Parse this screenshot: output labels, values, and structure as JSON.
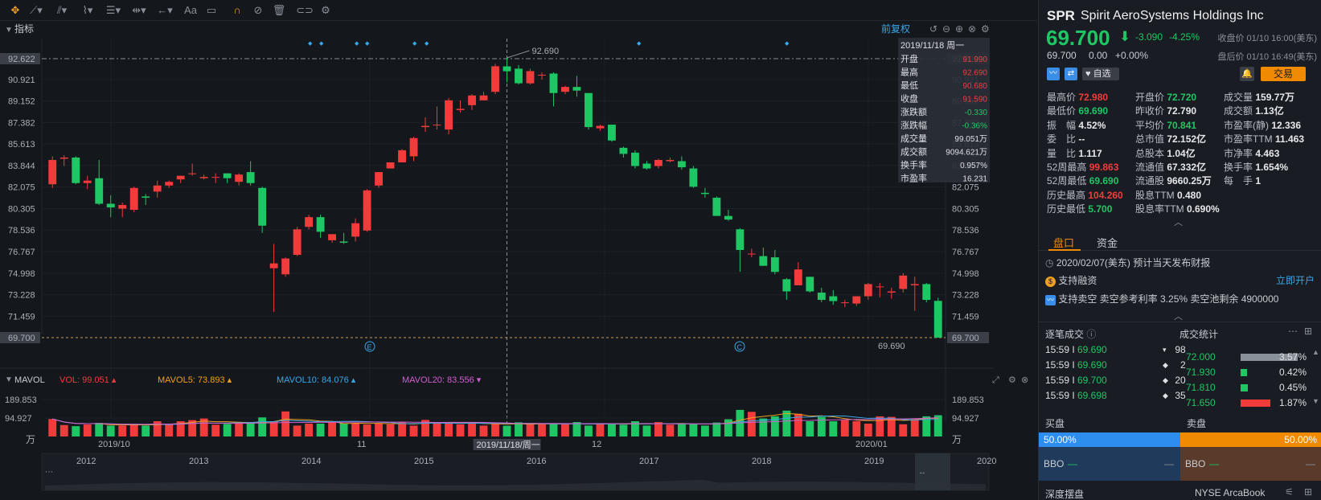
{
  "toolbar": {
    "icons": [
      "crosshair-icon",
      "line-tool-icon",
      "channel-tool-icon",
      "wave-tool-icon",
      "fib-tool-icon",
      "range-tool-icon",
      "undo-arrow-icon",
      "text-tool-icon",
      "comment-icon",
      "magnet-icon",
      "hide-icon",
      "delete-icon",
      "link-icon",
      "settings-icon"
    ],
    "text_tool": "Aa"
  },
  "chart": {
    "indicator_label": "指标",
    "adjust_label": "前复权",
    "high_marker": "92.690",
    "low_marker": "69.690",
    "crosshair_price": "92.622",
    "last_price_tag": "69.700",
    "price_ticks": [
      "92.622",
      "90.921",
      "89.152",
      "87.382",
      "85.613",
      "83.844",
      "82.075",
      "80.305",
      "78.536",
      "76.767",
      "74.998",
      "73.228",
      "71.459",
      "69.700"
    ],
    "event_e": "E",
    "event_c": "C",
    "tooltip": {
      "date": "2019/11/18 周一",
      "rows": [
        {
          "label": "开盘",
          "value": "91.990",
          "color": "red"
        },
        {
          "label": "最高",
          "value": "92.690",
          "color": "red"
        },
        {
          "label": "最低",
          "value": "90.680",
          "color": "red"
        },
        {
          "label": "收盘",
          "value": "91.590",
          "color": "red"
        },
        {
          "label": "涨跌额",
          "value": "-0.330",
          "color": "green"
        },
        {
          "label": "涨跌幅",
          "value": "-0.36%",
          "color": "green"
        },
        {
          "label": "成交量",
          "value": "99.051万",
          "color": "white"
        },
        {
          "label": "成交额",
          "value": "9094.621万",
          "color": "white"
        },
        {
          "label": "换手率",
          "value": "0.957%",
          "color": "white"
        },
        {
          "label": "市盈率",
          "value": "16.231",
          "color": "white"
        }
      ]
    },
    "colors": {
      "up": "#f23c3c",
      "down": "#1fc764",
      "ma5": "#f0a020",
      "ma10": "#3aa7e8",
      "ma20": "#d05fd0"
    }
  },
  "volume": {
    "title": "MAVOL",
    "vol": "VOL: 99.051",
    "ma5": "MAVOL5: 73.893",
    "ma10": "MAVOL10: 84.076",
    "ma20": "MAVOL20: 83.556",
    "ticks": [
      "189.853",
      "94.927"
    ],
    "unit": "万"
  },
  "xaxis": {
    "labels": [
      "2019/10",
      "11",
      "12",
      "2020/01"
    ],
    "crosshair_date": "2019/11/18/周一"
  },
  "overview": {
    "years": [
      "2012",
      "2013",
      "2014",
      "2015",
      "2016",
      "2017",
      "2018",
      "2019",
      "2020"
    ]
  },
  "quote": {
    "symbol": "SPR",
    "name": "Spirit AeroSystems Holdings Inc",
    "price": "69.700",
    "arrow": "⬇",
    "change": "-3.090",
    "change_pct": "-4.25%",
    "close_time": "收盘价 01/10 16:00(美东)",
    "after_price": "69.700",
    "after_change": "0.00",
    "after_pct": "+0.00%",
    "after_time": "盘后价 01/10 16:49(美东)",
    "watch_label": "自选",
    "trade_label": "交易"
  },
  "stats": [
    [
      {
        "label": "最高价",
        "value": "72.980",
        "color": "red"
      },
      {
        "label": "开盘价",
        "value": "72.720",
        "color": "green"
      },
      {
        "label": "成交量",
        "value": "159.77万",
        "color": "white"
      }
    ],
    [
      {
        "label": "最低价",
        "value": "69.690",
        "color": "green"
      },
      {
        "label": "昨收价",
        "value": "72.790",
        "color": "white"
      },
      {
        "label": "成交额",
        "value": "1.13亿",
        "color": "white"
      }
    ],
    [
      {
        "label": "振　幅",
        "value": "4.52%",
        "color": "white"
      },
      {
        "label": "平均价",
        "value": "70.841",
        "color": "green"
      },
      {
        "label": "市盈率(静)",
        "value": "12.336",
        "color": "white"
      }
    ],
    [
      {
        "label": "委　比",
        "value": "--",
        "color": "white"
      },
      {
        "label": "总市值",
        "value": "72.152亿",
        "color": "white"
      },
      {
        "label": "市盈率TTM",
        "value": "11.463",
        "color": "white"
      }
    ],
    [
      {
        "label": "量　比",
        "value": "1.117",
        "color": "white"
      },
      {
        "label": "总股本",
        "value": "1.04亿",
        "color": "white"
      },
      {
        "label": "市净率",
        "value": "4.463",
        "color": "white"
      }
    ],
    [
      {
        "label": "52周最高",
        "value": "99.863",
        "color": "red"
      },
      {
        "label": "流通值",
        "value": "67.332亿",
        "color": "white"
      },
      {
        "label": "换手率",
        "value": "1.654%",
        "color": "white"
      }
    ],
    [
      {
        "label": "52周最低",
        "value": "69.690",
        "color": "green"
      },
      {
        "label": "流通股",
        "value": "9660.25万",
        "color": "white"
      },
      {
        "label": "每　手",
        "value": "1",
        "color": "white"
      }
    ],
    [
      {
        "label": "历史最高",
        "value": "104.260",
        "color": "red"
      },
      {
        "label": "股息TTM",
        "value": "0.480",
        "color": "white"
      },
      {
        "label": "",
        "value": "",
        "color": "white"
      }
    ],
    [
      {
        "label": "历史最低",
        "value": "5.700",
        "color": "green"
      },
      {
        "label": "股息率TTM",
        "value": "0.690%",
        "color": "white"
      },
      {
        "label": "",
        "value": "",
        "color": "white"
      }
    ]
  ],
  "tabs": [
    "盘口",
    "资金"
  ],
  "notices": {
    "earnings": "2020/02/07(美东)   预计当天发布财报",
    "margin": "支持融资",
    "open_account": "立即开户",
    "short": "支持卖空  卖空参考利率 3.25%  卖空池剩余 4900000"
  },
  "ticks_panel": {
    "title": "逐笔成交",
    "rows": [
      {
        "time": "15:59 I",
        "price": "69.690",
        "vol": "98",
        "mark": "▾"
      },
      {
        "time": "15:59 I",
        "price": "69.690",
        "vol": "2",
        "mark": "◆"
      },
      {
        "time": "15:59 I",
        "price": "69.700",
        "vol": "20",
        "mark": "◆"
      },
      {
        "time": "15:59 I",
        "price": "69.698",
        "vol": "35",
        "mark": "◆"
      }
    ]
  },
  "volstat_panel": {
    "title": "成交统计",
    "rows": [
      {
        "price": "72.000",
        "pct": "3.57%",
        "frac": 0.357
      },
      {
        "price": "71.930",
        "pct": "0.42%",
        "frac": 0.042
      },
      {
        "price": "71.810",
        "pct": "0.45%",
        "frac": 0.045
      },
      {
        "price": "71.650",
        "pct": "1.87%",
        "frac": 0.187
      }
    ]
  },
  "book": {
    "bid_label": "买盘",
    "ask_label": "卖盘",
    "bid_pct": "50.00%",
    "ask_pct": "50.00%",
    "bbo_label": "BBO",
    "dash": "—"
  },
  "footer": {
    "depth_label": "深度摆盘",
    "venue": "NYSE ArcaBook"
  },
  "chart_data": {
    "type": "candlestick",
    "candles": [
      [
        82.3,
        84.6,
        82.0,
        84.3
      ],
      [
        84.4,
        84.7,
        83.8,
        84.5
      ],
      [
        84.5,
        84.6,
        82.3,
        82.4
      ],
      [
        82.4,
        83.0,
        81.9,
        82.6
      ],
      [
        82.8,
        84.3,
        80.6,
        80.7
      ],
      [
        80.7,
        81.4,
        79.6,
        80.4
      ],
      [
        80.3,
        80.8,
        79.6,
        80.6
      ],
      [
        80.2,
        82.1,
        80.0,
        82.0
      ],
      [
        81.3,
        81.5,
        80.6,
        81.2
      ],
      [
        81.7,
        82.6,
        81.2,
        82.2
      ],
      [
        82.2,
        82.6,
        82.0,
        82.5
      ],
      [
        82.7,
        83.0,
        82.4,
        83.0
      ],
      [
        83.2,
        84.0,
        83.0,
        83.2
      ],
      [
        82.8,
        83.1,
        82.7,
        82.9
      ],
      [
        82.9,
        83.2,
        82.4,
        82.9
      ],
      [
        83.2,
        83.2,
        82.4,
        82.8
      ],
      [
        82.5,
        83.2,
        82.2,
        83.1
      ],
      [
        83.3,
        84.2,
        82.2,
        82.4
      ],
      [
        82.0,
        82.1,
        78.3,
        78.9
      ],
      [
        75.4,
        77.4,
        71.8,
        75.8
      ],
      [
        74.9,
        76.3,
        74.7,
        76.2
      ],
      [
        76.5,
        78.8,
        76.4,
        78.6
      ],
      [
        78.8,
        79.8,
        78.6,
        79.6
      ],
      [
        79.6,
        79.8,
        77.9,
        78.4
      ],
      [
        77.7,
        78.2,
        77.5,
        78.2
      ],
      [
        77.6,
        78.3,
        77.4,
        77.5
      ],
      [
        78.0,
        79.5,
        77.6,
        79.1
      ],
      [
        78.5,
        81.9,
        78.4,
        81.8
      ],
      [
        82.2,
        83.3,
        82.0,
        83.3
      ],
      [
        83.6,
        84.1,
        83.6,
        84.1
      ],
      [
        84.1,
        85.2,
        84.1,
        85.1
      ],
      [
        84.6,
        86.2,
        84.2,
        86.1
      ],
      [
        87.0,
        87.8,
        86.6,
        87.1
      ],
      [
        87.2,
        88.7,
        86.8,
        87.2
      ],
      [
        86.8,
        89.4,
        86.4,
        89.2
      ],
      [
        88.4,
        89.2,
        88.2,
        88.5
      ],
      [
        88.8,
        89.7,
        88.4,
        89.6
      ],
      [
        89.2,
        89.9,
        89.2,
        89.6
      ],
      [
        89.9,
        92.2,
        89.7,
        92.0
      ],
      [
        91.99,
        92.69,
        90.68,
        91.59
      ],
      [
        91.8,
        92.1,
        90.5,
        90.6
      ],
      [
        90.6,
        91.8,
        90.5,
        91.6
      ],
      [
        91.3,
        91.5,
        90.9,
        91.3
      ],
      [
        91.4,
        91.5,
        88.7,
        89.8
      ],
      [
        89.9,
        90.4,
        89.7,
        90.3
      ],
      [
        90.3,
        91.2,
        89.5,
        90.0
      ],
      [
        89.8,
        89.8,
        86.8,
        87.0
      ],
      [
        86.9,
        87.2,
        86.7,
        87.1
      ],
      [
        87.2,
        87.2,
        85.8,
        85.9
      ],
      [
        85.3,
        85.4,
        84.5,
        84.8
      ],
      [
        84.9,
        85.1,
        83.6,
        83.8
      ],
      [
        84.0,
        84.2,
        83.5,
        83.6
      ],
      [
        83.8,
        84.4,
        83.6,
        84.3
      ],
      [
        84.2,
        84.5,
        84.1,
        84.3
      ],
      [
        84.2,
        84.6,
        83.5,
        83.7
      ],
      [
        83.6,
        83.8,
        82.0,
        82.1
      ],
      [
        81.6,
        82.0,
        81.2,
        81.5
      ],
      [
        81.2,
        81.3,
        79.7,
        79.7
      ],
      [
        79.7,
        80.2,
        79.3,
        79.4
      ],
      [
        78.6,
        78.7,
        75.1,
        76.9
      ],
      [
        76.6,
        77.0,
        76.3,
        76.6
      ],
      [
        76.4,
        77.1,
        75.6,
        75.6
      ],
      [
        76.3,
        76.9,
        74.9,
        75.1
      ],
      [
        74.5,
        74.6,
        72.8,
        73.5
      ],
      [
        74.0,
        75.9,
        74.0,
        75.3
      ],
      [
        74.7,
        74.7,
        73.4,
        73.5
      ],
      [
        73.4,
        73.8,
        72.6,
        72.8
      ],
      [
        73.1,
        73.6,
        72.4,
        72.7
      ],
      [
        72.6,
        72.8,
        72.2,
        72.6
      ],
      [
        72.5,
        73.1,
        72.3,
        73.1
      ],
      [
        73.1,
        74.2,
        72.8,
        74.1
      ],
      [
        73.9,
        74.2,
        73.0,
        73.9
      ],
      [
        73.4,
        73.8,
        72.9,
        73.5
      ],
      [
        73.7,
        75.0,
        73.4,
        74.8
      ],
      [
        74.0,
        74.7,
        71.9,
        74.1
      ],
      [
        74.1,
        74.2,
        72.6,
        72.8
      ],
      [
        72.72,
        72.98,
        69.69,
        69.7
      ]
    ],
    "volume": [
      160,
      105,
      95,
      110,
      125,
      100,
      100,
      105,
      100,
      140,
      115,
      140,
      150,
      165,
      108,
      115,
      118,
      132,
      175,
      140,
      230,
      100,
      118,
      118,
      130,
      122,
      122,
      110,
      120,
      112,
      130,
      100,
      152,
      132,
      120,
      112,
      130,
      100,
      125,
      99,
      130,
      110,
      120,
      112,
      115,
      132,
      100,
      118,
      115,
      108,
      140,
      100,
      132,
      108,
      118,
      116,
      100,
      128,
      158,
      244,
      226,
      165,
      185,
      237,
      208,
      140,
      180,
      140,
      150,
      140,
      118,
      185,
      180,
      112,
      165,
      185,
      195,
      198,
      170,
      180
    ],
    "volume_colors": [
      "down-red",
      "down",
      "down",
      "down",
      "down-red",
      "down-red",
      "red",
      "red",
      "red",
      "red",
      "red",
      "red",
      "red",
      "red",
      "red",
      "red",
      "red",
      "red",
      "down",
      "down",
      "down",
      "down",
      "down",
      "down",
      "down",
      "down",
      "red",
      "red",
      "red",
      "red",
      "red",
      "red",
      "red",
      "red",
      "red",
      "red",
      "red",
      "red",
      "red",
      "down",
      "down",
      "down",
      "down",
      "down",
      "down",
      "down",
      "down",
      "down",
      "down",
      "down",
      "down",
      "down",
      "down",
      "down",
      "down",
      "down",
      "down",
      "down",
      "down",
      "down",
      "down",
      "down",
      "down",
      "down",
      "down",
      "down",
      "down",
      "down",
      "down",
      "down",
      "red",
      "down",
      "down",
      "red",
      "down",
      "down",
      "down",
      "down",
      "down",
      "down"
    ],
    "price_range": [
      69.7,
      92.622
    ],
    "volume_range": [
      0,
      189.853
    ]
  }
}
